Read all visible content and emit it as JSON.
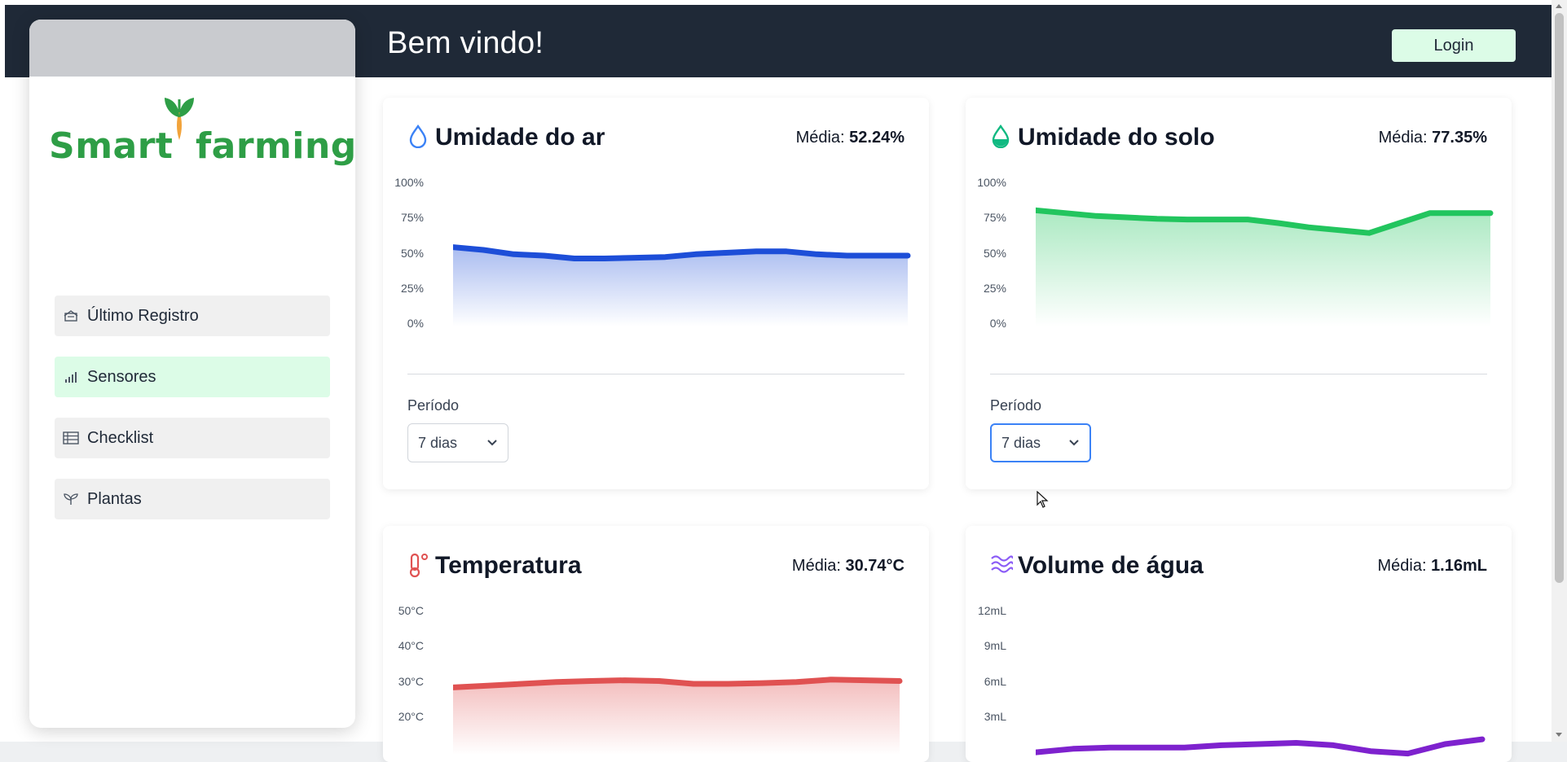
{
  "header": {
    "title": "Bem vindo!",
    "login_label": "Login"
  },
  "brand": {
    "name_part1": "Smart",
    "name_part2": "farming"
  },
  "sidebar": {
    "items": [
      {
        "label": "Último Registro",
        "icon": "cabinet-icon",
        "active": false
      },
      {
        "label": "Sensores",
        "icon": "signal-bars-icon",
        "active": true
      },
      {
        "label": "Checklist",
        "icon": "table-icon",
        "active": false
      },
      {
        "label": "Plantas",
        "icon": "sprout-icon",
        "active": false
      }
    ]
  },
  "colors": {
    "air": "#1d4ed8",
    "soil": "#22c55e",
    "temp": "#e05252",
    "water": "#7e22ce",
    "active_nav": "#dcfce7",
    "topbar": "#1f2937"
  },
  "cards": [
    {
      "title": "Umidade do ar",
      "icon": "droplet-outline-icon",
      "avg_label": "Média:",
      "avg_value": "52.24%",
      "period_label": "Período",
      "period_value": "7 dias"
    },
    {
      "title": "Umidade do solo",
      "icon": "droplet-half-icon",
      "avg_label": "Média:",
      "avg_value": "77.35%",
      "period_label": "Período",
      "period_value": "7 dias"
    },
    {
      "title": "Temperatura",
      "icon": "thermometer-icon",
      "avg_label": "Média:",
      "avg_value": "30.74°C"
    },
    {
      "title": "Volume de água",
      "icon": "waves-icon",
      "avg_label": "Média:",
      "avg_value": "1.16mL"
    }
  ],
  "chart_data": [
    {
      "type": "area",
      "ticks": [
        "100%",
        "75%",
        "50%",
        "25%",
        "0%"
      ],
      "ylim": [
        0,
        100
      ],
      "values": [
        56,
        54,
        51,
        50,
        48,
        48,
        48.5,
        49,
        51,
        52,
        53,
        53,
        51,
        50,
        50,
        50
      ]
    },
    {
      "type": "area",
      "ticks": [
        "100%",
        "75%",
        "50%",
        "25%",
        "0%"
      ],
      "ylim": [
        0,
        100
      ],
      "values": [
        82,
        80,
        78,
        77,
        76,
        75.5,
        75.5,
        75.5,
        73,
        70,
        68,
        66,
        73,
        80,
        80,
        80
      ]
    },
    {
      "type": "area",
      "ticks": [
        "50°C",
        "40°C",
        "30°C",
        "20°C"
      ],
      "ylim": [
        10,
        50
      ],
      "values": [
        29,
        29.5,
        30,
        30.5,
        30.8,
        31,
        30.8,
        30,
        30,
        30.2,
        30.5,
        31.2,
        31,
        30.8
      ]
    },
    {
      "type": "line",
      "ticks": [
        "12mL",
        "9mL",
        "6mL",
        "3mL"
      ],
      "ylim": [
        0,
        12
      ],
      "values": [
        0.2,
        0.5,
        0.6,
        0.6,
        0.6,
        0.8,
        0.9,
        1.0,
        0.8,
        0.3,
        0.1,
        0.9,
        1.3
      ]
    }
  ]
}
